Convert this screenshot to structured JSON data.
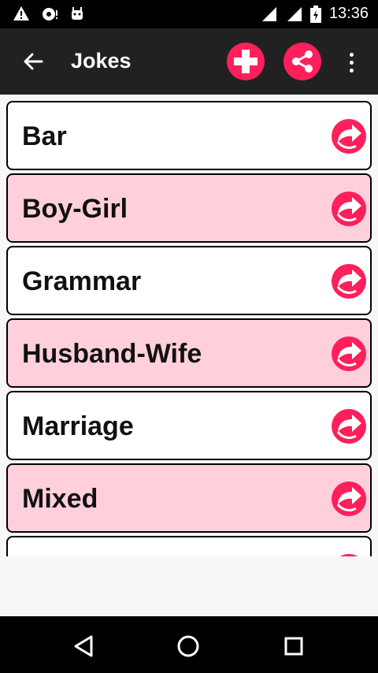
{
  "status_bar": {
    "time": "13:36",
    "icons": [
      "warning-icon",
      "alarm-icon",
      "android-icon",
      "wifi-icon",
      "signal-icon",
      "battery-charging-icon"
    ]
  },
  "app_bar": {
    "title": "Jokes",
    "back_icon": "arrow-left-icon",
    "actions": [
      "plus-icon",
      "share-icon",
      "more-vert-icon"
    ]
  },
  "colors": {
    "accent": "#ff1f5b",
    "row_pink": "#ffd0dc",
    "row_white": "#ffffff",
    "appbar": "#212121"
  },
  "categories": [
    {
      "label": "Bar",
      "bg": "#ffffff"
    },
    {
      "label": "Boy-Girl",
      "bg": "#ffd0dc"
    },
    {
      "label": "Grammar",
      "bg": "#ffffff"
    },
    {
      "label": "Husband-Wife",
      "bg": "#ffd0dc"
    },
    {
      "label": "Marriage",
      "bg": "#ffffff"
    },
    {
      "label": "Mixed",
      "bg": "#ffd0dc"
    },
    {
      "label": "",
      "bg": "#ffffff"
    }
  ],
  "nav": [
    "back-triangle-icon",
    "home-circle-icon",
    "recents-square-icon"
  ]
}
